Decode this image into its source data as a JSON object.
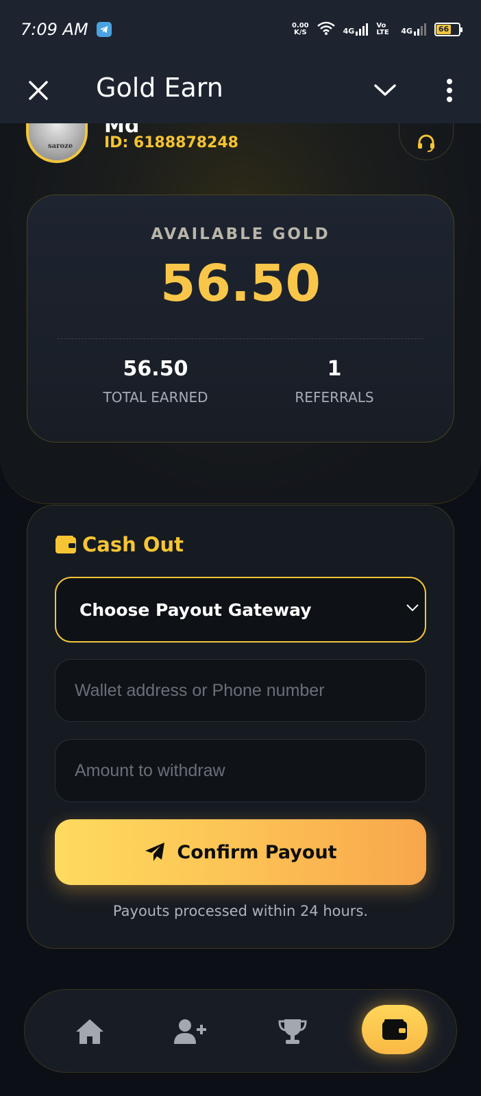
{
  "status_bar": {
    "time": "7:09 AM",
    "net_speed_value": "0.00",
    "net_speed_unit": "K/S",
    "signal_1": "4G",
    "volte": "Vo LTE",
    "signal_2": "4G",
    "battery": "66"
  },
  "app_bar": {
    "title": "Gold Earn",
    "icons": [
      "close-icon",
      "chevron-down-icon",
      "more-vertical-icon"
    ]
  },
  "profile": {
    "name": "Md",
    "id": "ID: 6188878248",
    "avatar_caption": "saroze",
    "support_icon": "headset-icon"
  },
  "balance": {
    "label": "AVAILABLE GOLD",
    "amount": "56.50",
    "total_earned_value": "56.50",
    "total_earned_label": "TOTAL EARNED",
    "referrals_value": "1",
    "referrals_label": "REFERRALS"
  },
  "cashout": {
    "title": "Cash Out",
    "gateway_label": "Choose Payout Gateway",
    "wallet_placeholder": "Wallet address or Phone number",
    "amount_placeholder": "Amount to withdraw",
    "confirm_label": "Confirm Payout",
    "note": "Payouts processed within 24 hours."
  },
  "bottom_nav": {
    "items": [
      "home-icon",
      "add-user-icon",
      "trophy-icon",
      "wallet-icon"
    ],
    "active": "wallet-icon"
  },
  "colors": {
    "accent": "#f6c533",
    "background": "#0c1016",
    "card": "#1e2430"
  }
}
